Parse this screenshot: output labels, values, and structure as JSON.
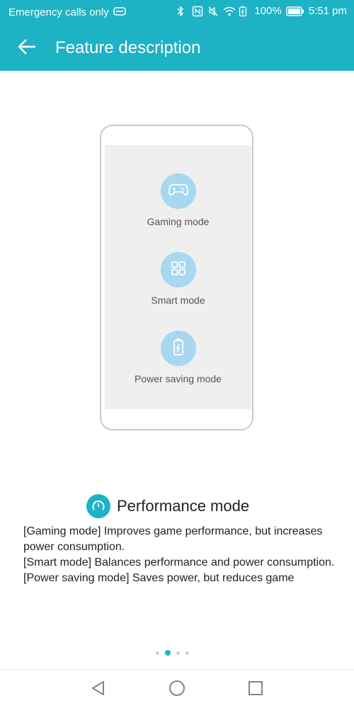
{
  "status_bar": {
    "carrier": "Emergency calls only",
    "battery": "100%",
    "time": "5:51 pm"
  },
  "app_bar": {
    "title": "Feature description"
  },
  "illustration": {
    "modes": [
      {
        "label": "Gaming mode",
        "icon": "gamepad-icon"
      },
      {
        "label": "Smart mode",
        "icon": "grid-icon"
      },
      {
        "label": "Power saving mode",
        "icon": "battery-icon"
      }
    ]
  },
  "section": {
    "title": "Performance mode",
    "icon": "speedometer-icon",
    "lines": [
      "[Gaming mode] Improves game performance, but increases power consumption.",
      "[Smart mode] Balances performance and power consumption.",
      "[Power saving mode] Saves power, but reduces game"
    ]
  },
  "pager": {
    "total": 4,
    "active_index": 1
  },
  "colors": {
    "accent": "#1eb2c5",
    "mode_circle": "#a7d8ef"
  }
}
